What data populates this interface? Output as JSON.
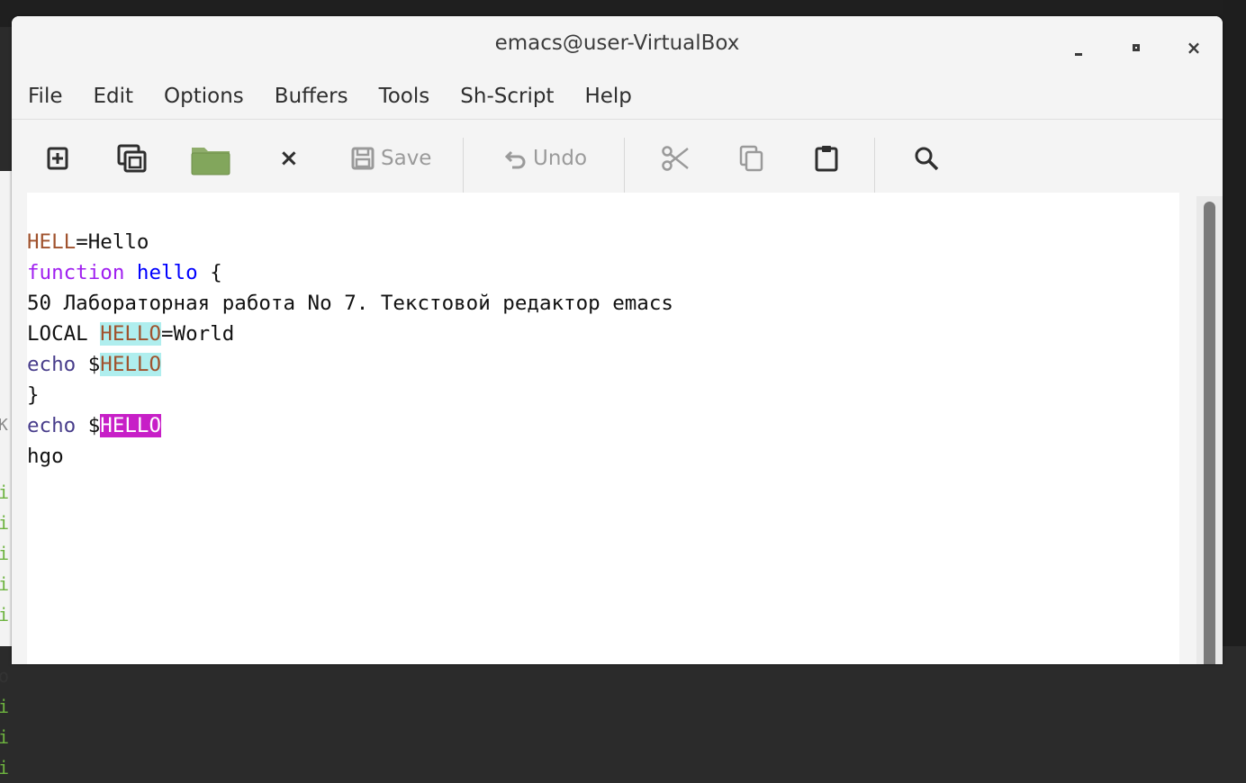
{
  "window": {
    "title": "emacs@user-VirtualBox"
  },
  "menu": [
    "File",
    "Edit",
    "Options",
    "Buffers",
    "Tools",
    "Sh-Script",
    "Help"
  ],
  "toolbar": {
    "new_file": "new-file-icon",
    "new_frame": "copy-frame-icon",
    "open": "folder-icon",
    "close": "×",
    "save": "Save",
    "undo": "Undo",
    "cut": "cut-icon",
    "copy": "copy-icon",
    "paste": "paste-icon",
    "search": "search-icon"
  },
  "buffer": {
    "l1_var": "HELL",
    "l1_rest": "=Hello",
    "l2_kw": "function",
    "l2_fn": "hello",
    "l2_rest": " {",
    "l3": "50 Лабораторная работа No 7. Текстовой редактор emacs",
    "l4_a": "LOCAL ",
    "l4_var": "HELLO",
    "l4_rest": "=World",
    "l5_cmd": "echo",
    "l5_dollar": " $",
    "l5_var": "HELLO",
    "l6": "}",
    "l7_cmd": "echo",
    "l7_dollar": " $",
    "l7_var": "HELLO",
    "l8": "hgo"
  },
  "background_window": {
    "chars": [
      "K",
      "i",
      "i",
      "i",
      "i",
      "i",
      "o",
      "i",
      "i",
      "i"
    ]
  },
  "colors": {
    "variable": "#a0522d",
    "keyword": "#a020f0",
    "function_name": "#0000ff",
    "builtin": "#483d8b",
    "highlight_cyan": "#afeeee",
    "highlight_magenta": "#c71fc7"
  }
}
